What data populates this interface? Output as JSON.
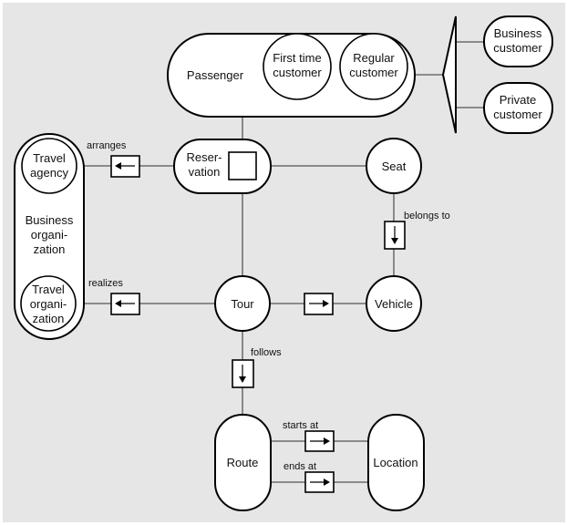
{
  "entities": {
    "passenger": "Passenger",
    "first_time_customer": [
      "First time",
      "customer"
    ],
    "regular_customer": [
      "Regular",
      "customer"
    ],
    "business_customer": [
      "Business",
      "customer"
    ],
    "private_customer": [
      "Private",
      "customer"
    ],
    "reservation": [
      "Reser-",
      "vation"
    ],
    "seat": "Seat",
    "business_organization": [
      "Business",
      "organi-",
      "zation"
    ],
    "travel_agency": [
      "Travel",
      "agency"
    ],
    "travel_organization": [
      "Travel",
      "organi-",
      "zation"
    ],
    "tour": "Tour",
    "vehicle": "Vehicle",
    "route": "Route",
    "location": "Location"
  },
  "relations": {
    "arranges": "arranges",
    "realizes": "realizes",
    "belongs_to": "belongs to",
    "follows": "follows",
    "starts_at": "starts at",
    "ends_at": "ends at"
  },
  "colors": {
    "background": "#e6e6e6",
    "shape_fill": "#ffffff",
    "stroke": "#000000"
  }
}
